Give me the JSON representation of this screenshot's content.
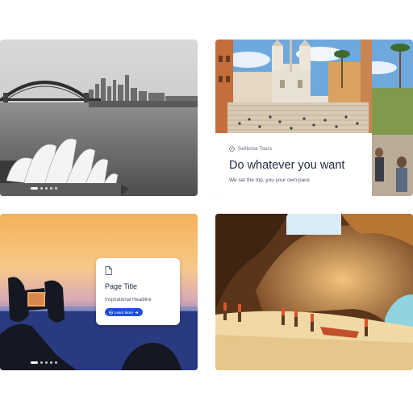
{
  "cards": {
    "sydney": {
      "carousel_pages": 5,
      "active_page": 1
    },
    "rome": {
      "brand": "Sellbrise Tours",
      "brand_icon": "compass-icon",
      "title": "Do whatever you want",
      "subtitle": "We set the trip, you your own pace"
    },
    "sunset": {
      "popup": {
        "icon": "document-icon",
        "title": "Page Title",
        "subtitle": "Inspirational Headline",
        "button_label": "Learn More",
        "button_color": "#1f4fd8"
      },
      "carousel_pages": 5,
      "active_page": 1
    },
    "cave": {}
  }
}
